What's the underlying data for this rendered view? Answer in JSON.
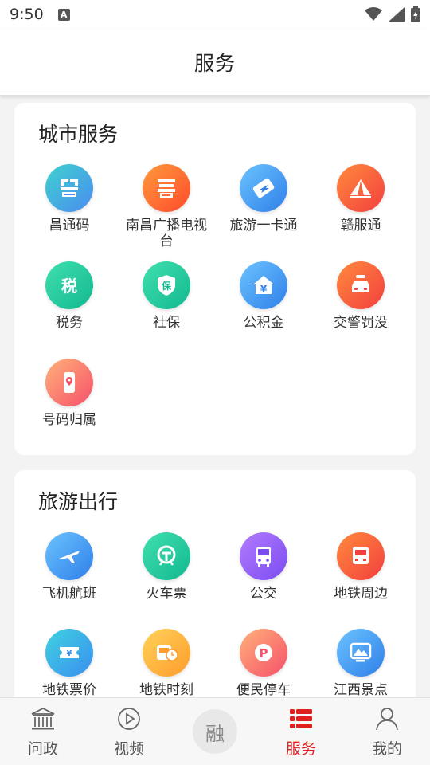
{
  "status_bar": {
    "time": "9:50",
    "notification_glyph": "A"
  },
  "header": {
    "title": "服务"
  },
  "sections": [
    {
      "title": "城市服务",
      "items": [
        {
          "label": "昌通码",
          "icon": "qr-code-icon",
          "colors": [
            "#3fd2cf",
            "#4b8cf0"
          ]
        },
        {
          "label": "南昌广播电视台",
          "icon": "tv-station-icon",
          "colors": [
            "#ff9a3c",
            "#ff4b2b"
          ]
        },
        {
          "label": "旅游一卡通",
          "icon": "travel-card-icon",
          "colors": [
            "#6cc3ff",
            "#2f7fe8"
          ]
        },
        {
          "label": "赣服通",
          "icon": "gan-service-icon",
          "colors": [
            "#ff8a3c",
            "#f23f3f"
          ]
        },
        {
          "label": "税务",
          "icon": "tax-icon",
          "colors": [
            "#3fe0b0",
            "#14b88f"
          ]
        },
        {
          "label": "社保",
          "icon": "social-security-icon",
          "colors": [
            "#3fe0b0",
            "#14b88f"
          ]
        },
        {
          "label": "公积金",
          "icon": "housing-fund-icon",
          "colors": [
            "#6cc3ff",
            "#2f7fe8"
          ]
        },
        {
          "label": "交警罚没",
          "icon": "traffic-police-icon",
          "colors": [
            "#ff8a3c",
            "#f23f3f"
          ]
        },
        {
          "label": "号码归属",
          "icon": "phone-location-icon",
          "colors": [
            "#ffb27a",
            "#f5506a"
          ]
        }
      ]
    },
    {
      "title": "旅游出行",
      "items": [
        {
          "label": "飞机航班",
          "icon": "airplane-icon",
          "colors": [
            "#6cc3ff",
            "#2f7fe8"
          ]
        },
        {
          "label": "火车票",
          "icon": "train-icon",
          "colors": [
            "#3fe0b0",
            "#14b88f"
          ]
        },
        {
          "label": "公交",
          "icon": "bus-icon",
          "colors": [
            "#b37bff",
            "#7b4cf0"
          ]
        },
        {
          "label": "地铁周边",
          "icon": "metro-surroundings-icon",
          "colors": [
            "#ff8a3c",
            "#f23f3f"
          ]
        },
        {
          "label": "地铁票价",
          "icon": "metro-fare-icon",
          "colors": [
            "#3fd2e0",
            "#3a8ff0"
          ]
        },
        {
          "label": "地铁时刻",
          "icon": "metro-schedule-icon",
          "colors": [
            "#ffd25a",
            "#ff9c2b"
          ]
        },
        {
          "label": "便民停车",
          "icon": "parking-icon",
          "colors": [
            "#ffb27a",
            "#f5506a"
          ]
        },
        {
          "label": "江西景点",
          "icon": "scenic-spot-icon",
          "colors": [
            "#6cc3ff",
            "#2f7fe8"
          ]
        }
      ]
    }
  ],
  "bottom_nav": [
    {
      "label": "问政",
      "icon": "government-building-icon",
      "active": false
    },
    {
      "label": "视频",
      "icon": "play-circle-icon",
      "active": false
    },
    {
      "label": "融",
      "icon": "rong-center-icon",
      "active": false
    },
    {
      "label": "服务",
      "icon": "service-list-icon",
      "active": true
    },
    {
      "label": "我的",
      "icon": "person-icon",
      "active": false
    }
  ],
  "colors": {
    "accent": "#e02020",
    "background": "#f3f3f3"
  }
}
